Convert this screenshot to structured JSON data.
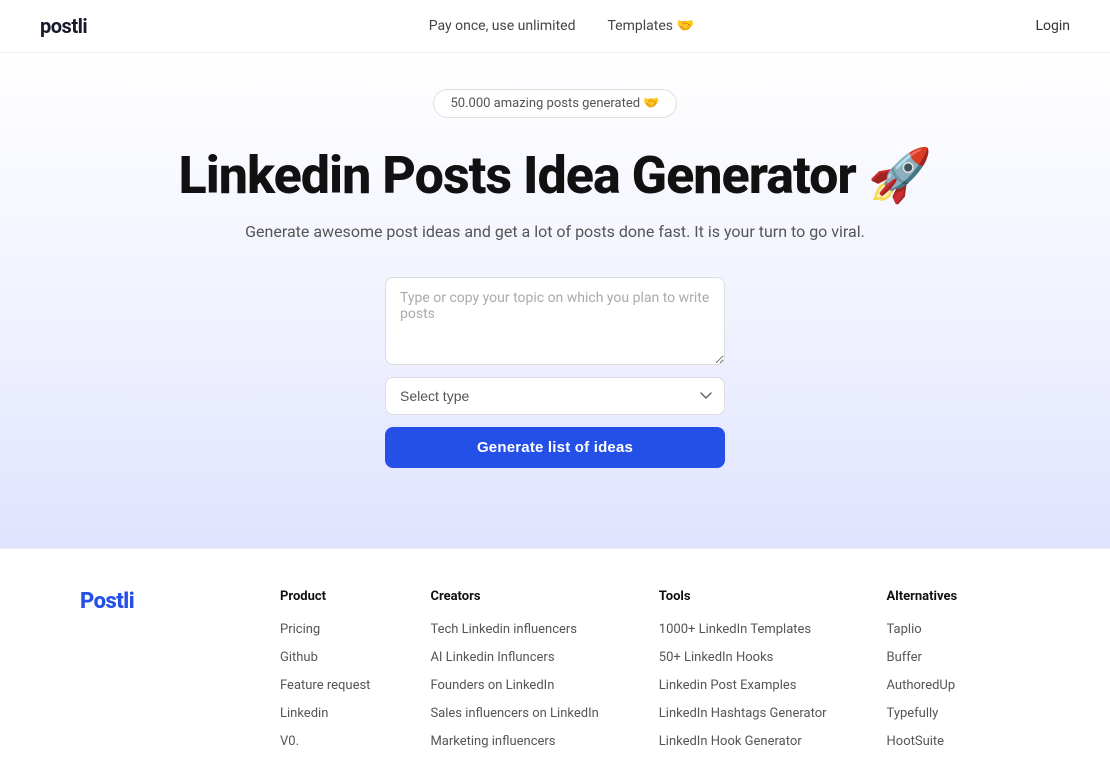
{
  "nav": {
    "logo": "postli",
    "cta": "Pay once, use unlimited",
    "templates_label": "Templates 🤝",
    "login_label": "Login"
  },
  "hero": {
    "badge_text": "50.000 amazing posts generated 🤝",
    "title": "Linkedin Posts Idea Generator 🚀",
    "subtitle": "Generate awesome post ideas and get a lot of posts done fast. It is your turn to go viral.",
    "textarea_placeholder": "Type or copy your topic on which you plan to write posts",
    "select_placeholder": "Select type",
    "button_label": "Generate list of ideas"
  },
  "footer": {
    "logo": "Postli",
    "columns": [
      {
        "heading": "Product",
        "links": [
          "Pricing",
          "Github",
          "Feature request",
          "Linkedin",
          "V0."
        ]
      },
      {
        "heading": "Creators",
        "links": [
          "Tech Linkedin influencers",
          "AI Linkedin Influncers",
          "Founders on LinkedIn",
          "Sales influencers on LinkedIn",
          "Marketing influencers"
        ]
      },
      {
        "heading": "Tools",
        "links": [
          "1000+ LinkedIn Templates",
          "50+ LinkedIn Hooks",
          "Linkedin Post Examples",
          "LinkedIn Hashtags Generator",
          "LinkedIn Hook Generator"
        ]
      },
      {
        "heading": "Alternatives",
        "links": [
          "Taplio",
          "Buffer",
          "AuthoredUp",
          "Typefully",
          "HootSuite"
        ]
      }
    ]
  }
}
